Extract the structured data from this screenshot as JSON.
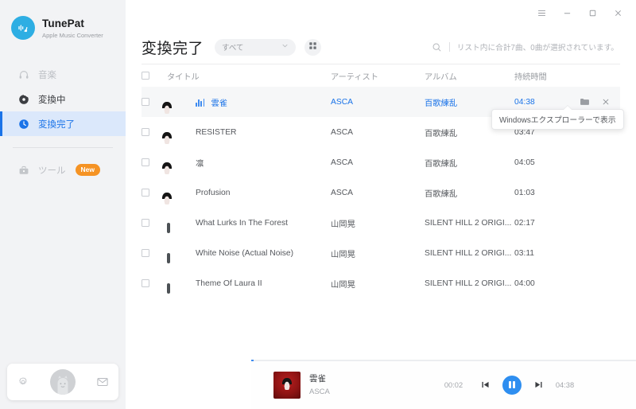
{
  "app": {
    "brand_name": "TunePat",
    "brand_subtitle": "Apple Music Converter"
  },
  "titlebar": {
    "menu_icon": "hamburger-menu-icon",
    "minimize_label": "–",
    "maximize_label": "□",
    "close_label": "✕"
  },
  "sidebar": {
    "items": [
      {
        "label": "音楽",
        "icon": "headphones-icon",
        "state": "disabled"
      },
      {
        "label": "変換中",
        "icon": "converting-icon",
        "state": "normal"
      },
      {
        "label": "変換完了",
        "icon": "clock-icon",
        "state": "active"
      }
    ],
    "tools": {
      "label": "ツール",
      "icon": "toolbox-icon",
      "badge": "New"
    },
    "bottom": {
      "settings_icon": "gear-icon",
      "avatar": "user-avatar",
      "mail_icon": "envelope-icon"
    }
  },
  "header": {
    "title": "変換完了",
    "filter_value": "すべて",
    "filter_options": [
      "すべて"
    ],
    "grid_view_icon": "grid-view-icon",
    "search_icon": "search-icon",
    "count_text": "リスト内に合計7曲、0曲が選択されています。"
  },
  "table": {
    "columns": [
      "タイトル",
      "アーティスト",
      "アルバム",
      "持続時間"
    ],
    "rows": [
      {
        "title": "雲雀",
        "artist": "ASCA",
        "album": "百歌練乱",
        "duration": "04:38",
        "art": "red",
        "selected": true,
        "playing": true
      },
      {
        "title": "RESISTER",
        "artist": "ASCA",
        "album": "百歌練乱",
        "duration": "03:47",
        "art": "red",
        "selected": false,
        "playing": false
      },
      {
        "title": "凛",
        "artist": "ASCA",
        "album": "百歌練乱",
        "duration": "04:05",
        "art": "red",
        "selected": false,
        "playing": false
      },
      {
        "title": "Profusion",
        "artist": "ASCA",
        "album": "百歌練乱",
        "duration": "01:03",
        "art": "red",
        "selected": false,
        "playing": false
      },
      {
        "title": "What Lurks In The Forest",
        "artist": "山岡晃",
        "album": "SILENT HILL 2 ORIGI...",
        "duration": "02:17",
        "art": "mist",
        "selected": false,
        "playing": false
      },
      {
        "title": "White Noise (Actual Noise)",
        "artist": "山岡晃",
        "album": "SILENT HILL 2 ORIGI...",
        "duration": "03:11",
        "art": "mist",
        "selected": false,
        "playing": false
      },
      {
        "title": "Theme Of Laura II",
        "artist": "山岡晃",
        "album": "SILENT HILL 2 ORIGI...",
        "duration": "04:00",
        "art": "mist",
        "selected": false,
        "playing": false
      }
    ],
    "row_actions": {
      "folder_icon": "folder-icon",
      "remove_icon": "close-icon"
    }
  },
  "tooltip": {
    "text": "Windowsエクスプローラーで表示"
  },
  "player": {
    "track_title": "雲雀",
    "track_artist": "ASCA",
    "elapsed": "00:02",
    "total": "04:38",
    "state": "playing",
    "previous_icon": "previous-track-icon",
    "play_pause_icon": "pause-icon",
    "next_icon": "next-track-icon",
    "progress_percent": 0.7
  },
  "colors": {
    "accent": "#1a73e8",
    "accent_soft": "#dbe8fb",
    "brand": "#2eaee3",
    "badge": "#f59324",
    "sidebar_bg": "#f2f3f5"
  }
}
